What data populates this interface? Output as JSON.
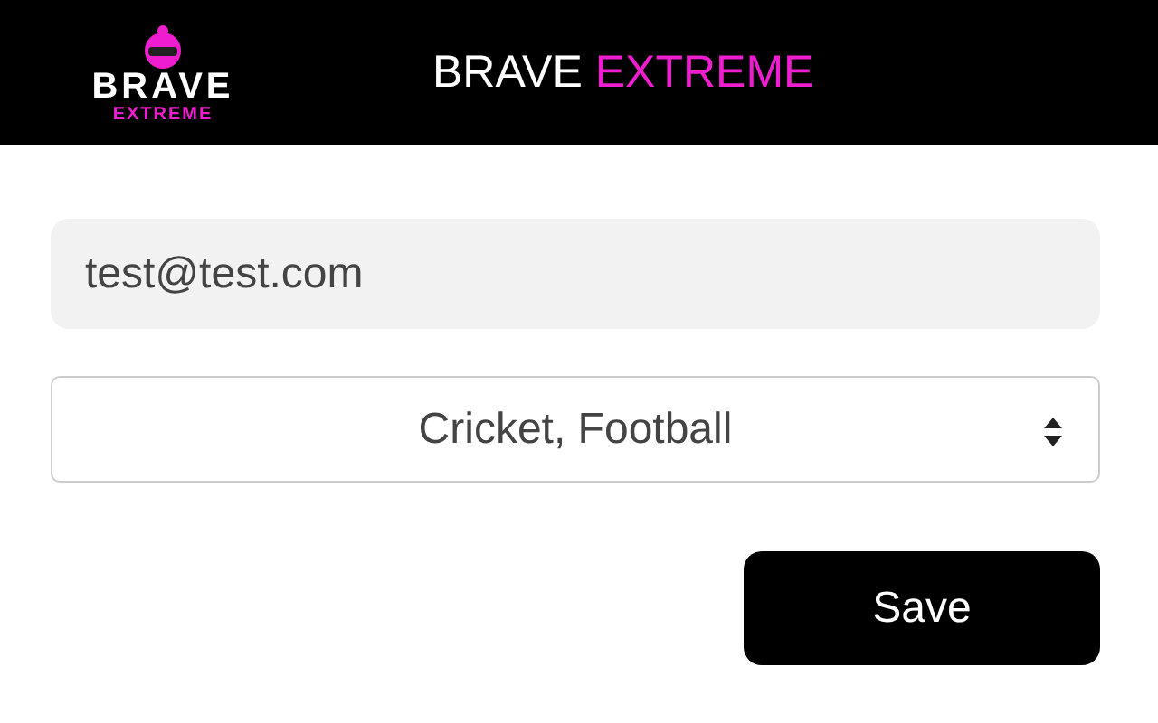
{
  "header": {
    "logo": {
      "line_1": "BRAVE",
      "line_2": "EXTREME"
    },
    "title": {
      "part_1": "BRAVE",
      "part_2": "EXTREME"
    }
  },
  "email_field": {
    "value": "test@test.com"
  },
  "sports_select": {
    "value": "Cricket, Football"
  },
  "buttons": [
    {
      "label": "Save"
    }
  ]
}
